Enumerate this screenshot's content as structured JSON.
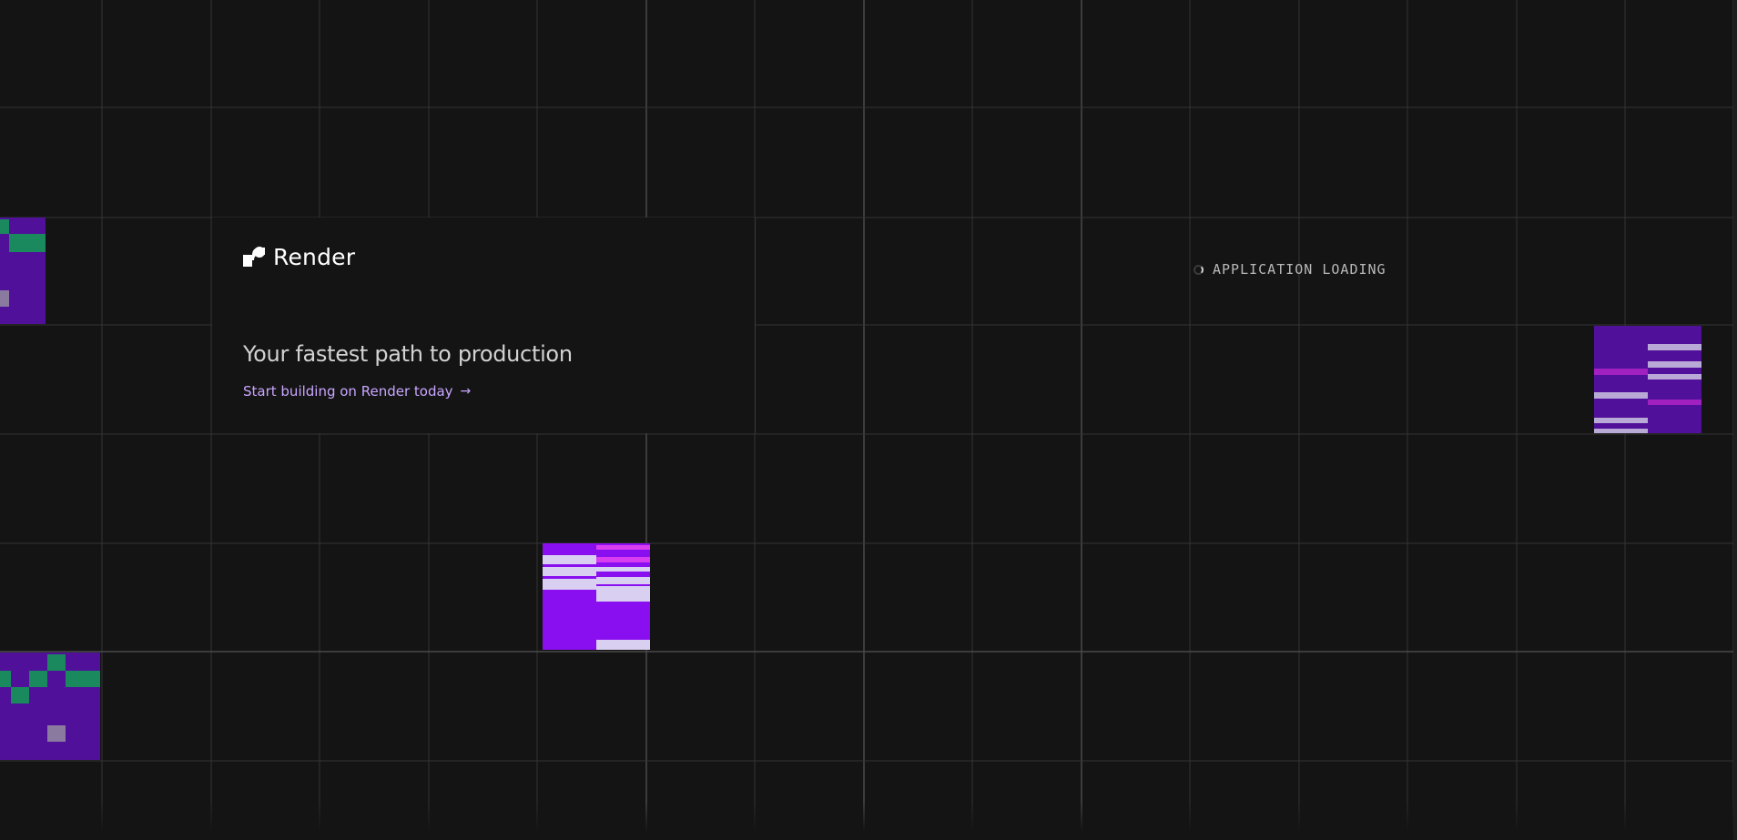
{
  "brand": {
    "name": "Render",
    "logo_icon": "render-logo-icon"
  },
  "promo": {
    "headline": "Your fastest path to production",
    "cta_label": "Start building on Render today",
    "cta_arrow": "→",
    "cta_icon": "arrow-right-icon"
  },
  "status": {
    "text": "APPLICATION LOADING",
    "icon": "loading-spinner-icon"
  },
  "colors": {
    "background": "#141414",
    "grid_line": "#3a3a3a",
    "accent_purple": "#8a0ff0",
    "deep_purple": "#50109a",
    "green": "#1a8a5e",
    "lavender": "#d9cff0",
    "magenta": "#d83ef0",
    "link": "#c9a6ff"
  }
}
